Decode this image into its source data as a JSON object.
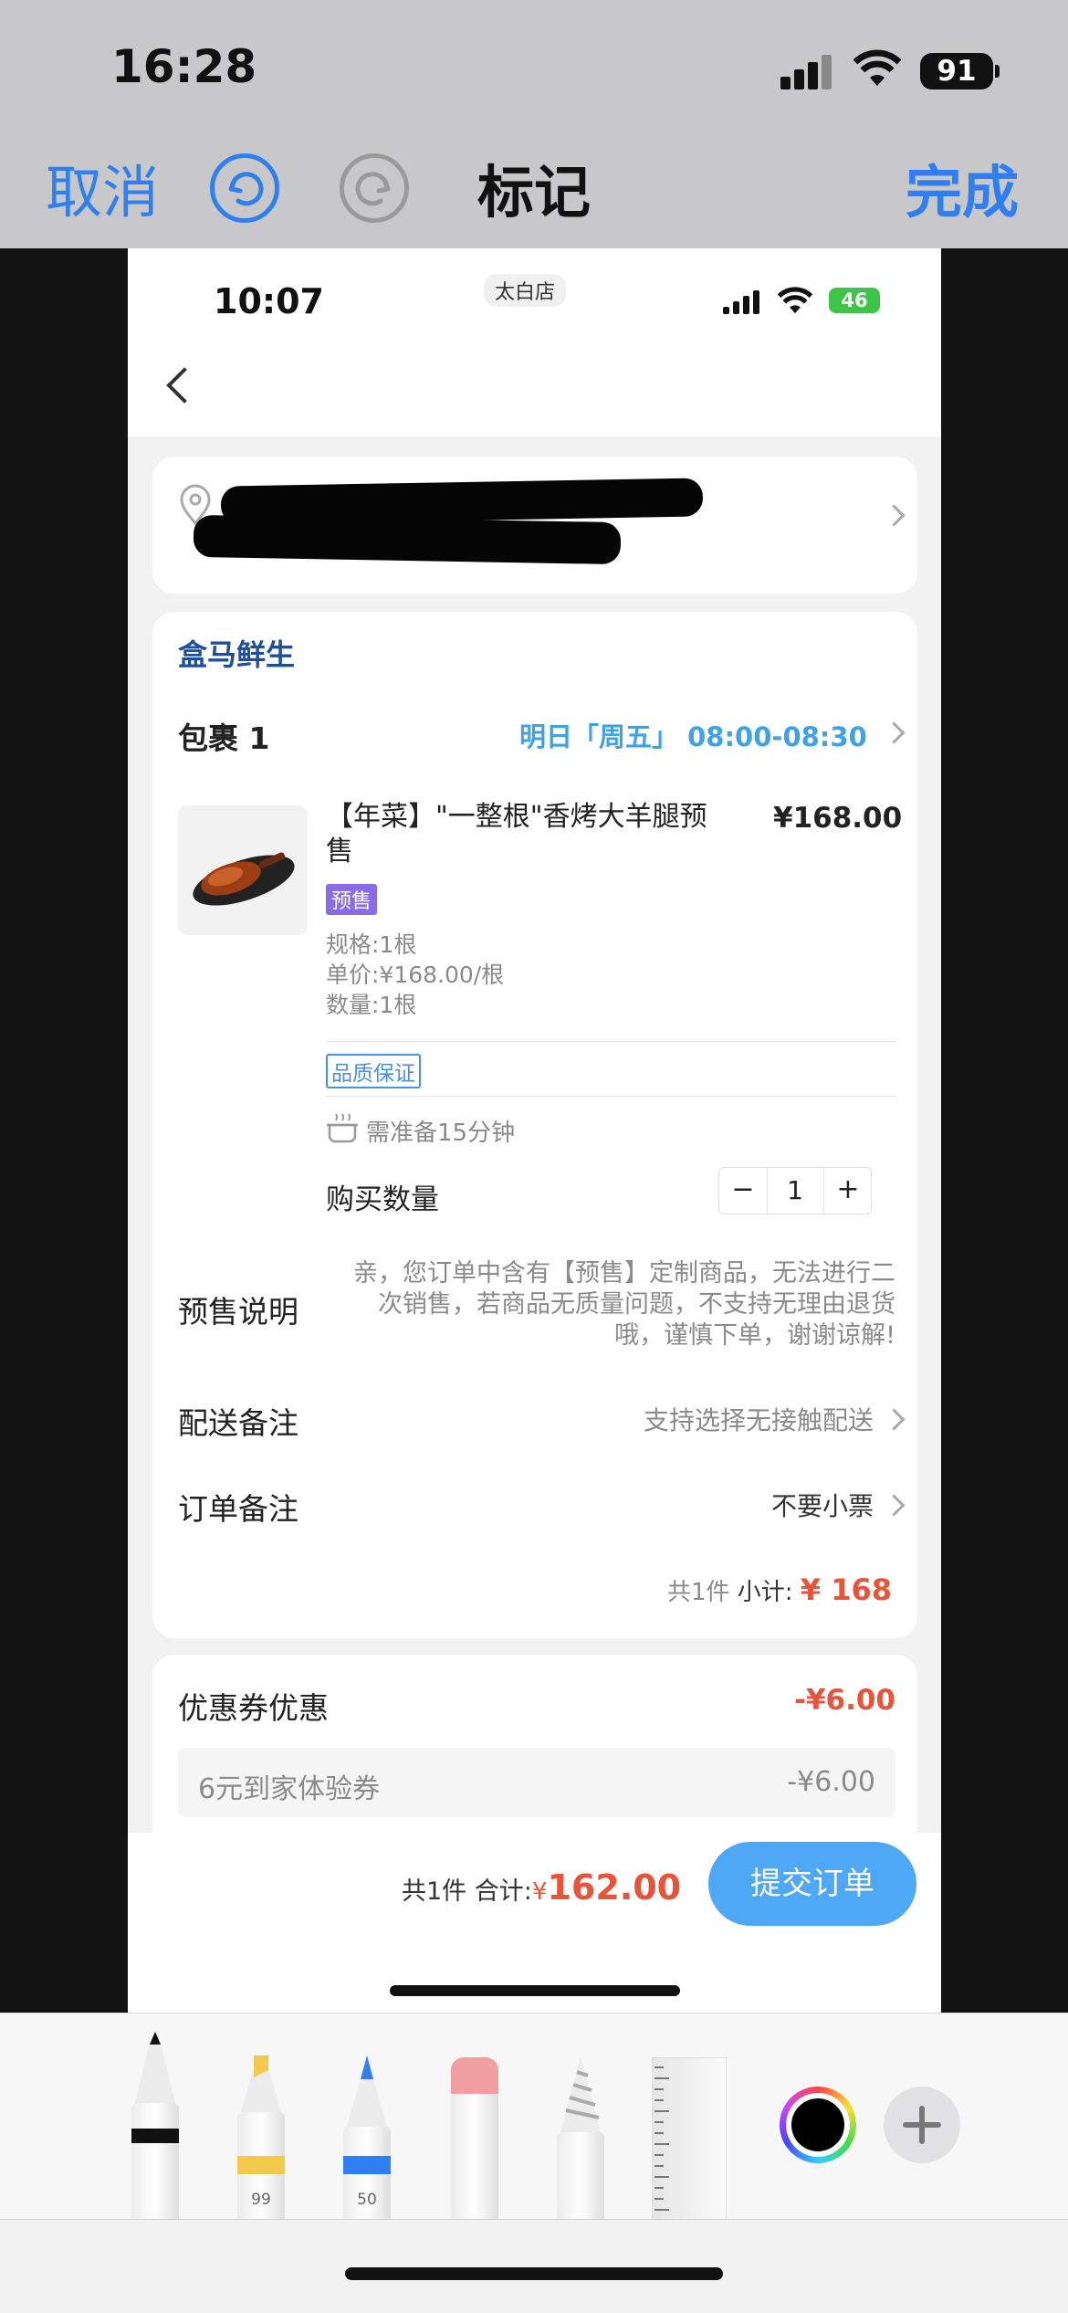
{
  "outer_status": {
    "time": "16:28",
    "battery": "91"
  },
  "markup_header": {
    "cancel": "取消",
    "title": "标记",
    "done": "完成"
  },
  "inner_status": {
    "time": "10:07",
    "store": "太白店",
    "battery": "46"
  },
  "store_name": "盒马鲜生",
  "package": {
    "label": "包裹 1",
    "delivery_time": "明日「周五」 08:00-08:30"
  },
  "product": {
    "name": "【年菜】\"一整根\"香烤大羊腿预售",
    "price": "¥168.00",
    "presale_badge": "预售",
    "spec": "规格:1根",
    "unit_price": "单价:¥168.00/根",
    "qty_text": "数量:1根",
    "quality_tag": "品质保证",
    "prep_time": "需准备15分钟",
    "buy_qty_label": "购买数量",
    "qty_minus": "−",
    "qty_value": "1",
    "qty_plus": "+"
  },
  "presale": {
    "label": "预售说明",
    "text": "亲，您订单中含有【预售】定制商品，无法进行二次销售，若商品无质量问题，不支持无理由退货哦，谨慎下单，谢谢谅解!"
  },
  "delivery_note": {
    "label": "配送备注",
    "value": "支持选择无接触配送"
  },
  "order_note": {
    "label": "订单备注",
    "value": "不要小票"
  },
  "subtotal": {
    "count": "共1件",
    "label": "小计:",
    "value": "¥ 168"
  },
  "coupon": {
    "label": "优惠券优惠",
    "value": "-¥6.00",
    "item": "6元到家体验券",
    "item_value": "-¥6.00"
  },
  "checkout": {
    "count": "共1件",
    "label": "合计:",
    "currency": "¥",
    "amount": "162.00",
    "submit": "提交订单"
  },
  "tools": {
    "marker_opacity": "99",
    "pen_opacity": "50"
  },
  "colors": {
    "accent_blue": "#2f7ff2",
    "price_red": "#e8533a",
    "submit_blue": "#4fa8f5",
    "presale_purple": "#8a6be8"
  }
}
